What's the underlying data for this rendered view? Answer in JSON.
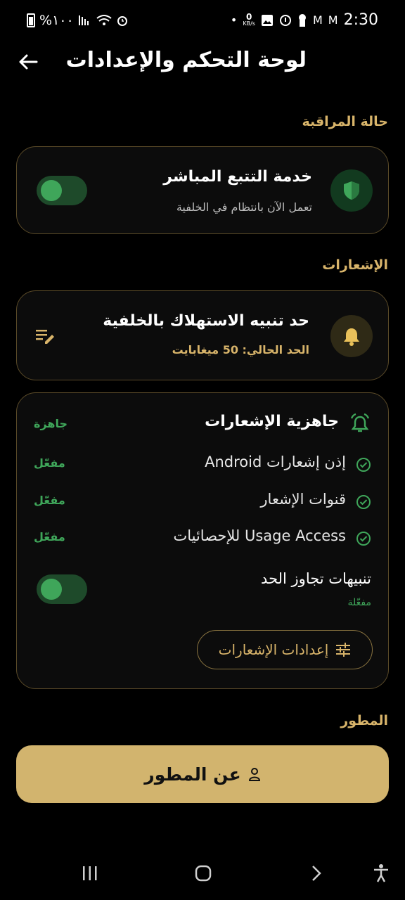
{
  "status_bar": {
    "battery_text": "%١٠٠",
    "time": "2:30",
    "net_speed": "0",
    "net_unit": "KB/s"
  },
  "app_bar": {
    "title": "لوحة التحكم والإعدادات"
  },
  "sections": {
    "monitoring": "حالة المراقبة",
    "notifications": "الإشعارات",
    "developer": "المطور"
  },
  "tracking_card": {
    "title": "خدمة التتبع المباشر",
    "subtitle": "تعمل الآن بانتظام في الخلفية",
    "toggle_on": true
  },
  "limit_card": {
    "title": "حد تنبيه الاستهلاك بالخلفية",
    "current_prefix": "الحد الحالي:",
    "current_value": "50 ميغابايت"
  },
  "readiness_card": {
    "title": "جاهزية الإشعارات",
    "title_status": "جاهزة",
    "rows": [
      {
        "label": "إذن إشعارات Android",
        "status": "مفعّل"
      },
      {
        "label": "قنوات الإشعار",
        "status": "مفعّل"
      },
      {
        "label": "Usage Access للإحصائيات",
        "status": "مفعّل"
      }
    ],
    "overlimit_title": "تنبيهات تجاوز الحد",
    "overlimit_status": "مفعّلة",
    "overlimit_toggle_on": true,
    "settings_button": "إعدادات الإشعارات"
  },
  "developer_button": "عن المطور",
  "colors": {
    "accent_gold": "#d2b46e",
    "status_green": "#3fa65a"
  },
  "icons": {
    "back": "arrow-left-icon",
    "shield": "shield-icon",
    "edit": "edit-list-icon",
    "bell": "bell-icon",
    "alarm": "alarm-bell-icon",
    "check": "check-circle-icon",
    "tune": "tune-icon",
    "person": "person-icon"
  }
}
